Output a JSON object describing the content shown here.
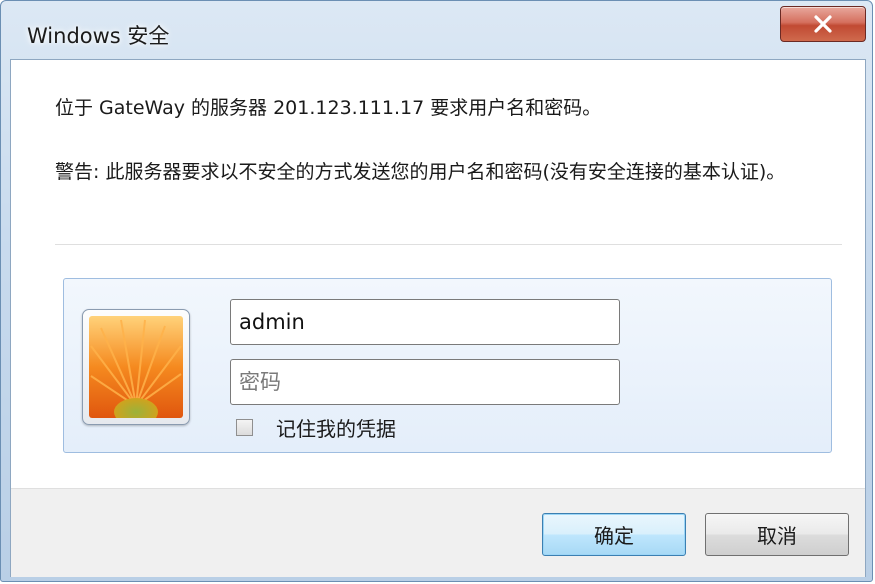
{
  "window": {
    "title": "Windows 安全",
    "close_icon": "close-icon"
  },
  "message": {
    "server_prompt": "位于 GateWay 的服务器 201.123.111.17 要求用户名和密码。",
    "warning": "警告: 此服务器要求以不安全的方式发送您的用户名和密码(没有安全连接的基本认证)。"
  },
  "credentials": {
    "avatar_icon": "flower-avatar-icon",
    "username_value": "admin",
    "password_placeholder": "密码",
    "remember_label": "记住我的凭据",
    "remember_checked": false
  },
  "buttons": {
    "ok_label": "确定",
    "cancel_label": "取消"
  },
  "colors": {
    "close_button": "#c14a33",
    "default_button_border": "#3c7fb1",
    "panel_border": "#9fbde0"
  }
}
